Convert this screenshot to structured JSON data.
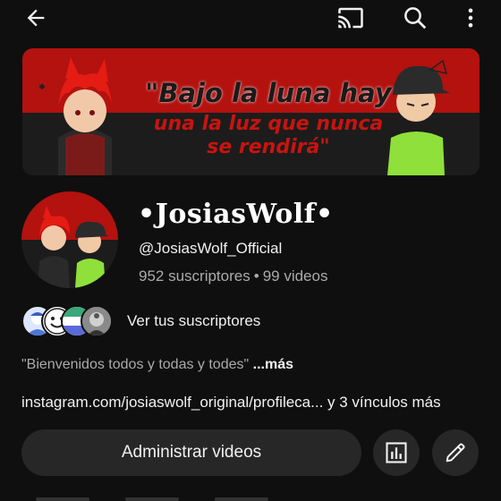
{
  "topbar": {
    "icons": [
      "back-arrow-icon",
      "cast-icon",
      "search-icon",
      "more-vert-icon"
    ]
  },
  "banner": {
    "quote_line1": "\"Bajo la luna hay",
    "quote_line2": "una la luz que nunca",
    "quote_line3": "se rendirá\"",
    "colors": {
      "top": "#b3120f",
      "bottom": "#1c1c1c",
      "quote_red": "#c8140f"
    }
  },
  "channel": {
    "name": "•JosiasWolf•",
    "handle": "@JosiasWolf_Official",
    "subscribers": "952 suscriptores",
    "separator": "•",
    "videos": "99 videos"
  },
  "subscribers_row": {
    "label": "Ver tus suscriptores"
  },
  "description": {
    "text": "\"Bienvenidos todos y todas y todes\"",
    "more": "...más"
  },
  "links": {
    "main": "instagram.com/josiaswolf_original/profileca...",
    "extra": " y 3 vínculos más"
  },
  "actions": {
    "manage_label": "Administrar videos",
    "icons": [
      "analytics-icon",
      "edit-pencil-icon"
    ]
  }
}
